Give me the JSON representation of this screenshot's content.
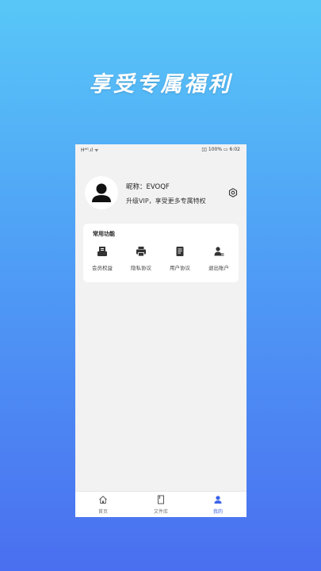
{
  "headline": "享受专属福利",
  "status_bar": {
    "left": "H⁴ᴳ.ıl ᯤ",
    "right": "▯▯ 100% ▭ 6:02"
  },
  "profile": {
    "nickname": "昵称：EVOQF",
    "vip_text": "升级VIP，享受更多专属特权"
  },
  "functions": {
    "title": "常用功能",
    "items": [
      {
        "label": "会员权益",
        "icon": "membership-icon"
      },
      {
        "label": "隐私协议",
        "icon": "printer-icon"
      },
      {
        "label": "用户协议",
        "icon": "document-icon"
      },
      {
        "label": "退出账户",
        "icon": "user-logout-icon"
      }
    ]
  },
  "tabs": [
    {
      "label": "首页",
      "icon": "home-icon"
    },
    {
      "label": "文件库",
      "icon": "file-icon"
    },
    {
      "label": "我的",
      "icon": "person-icon"
    }
  ],
  "colors": {
    "accent": "#3c64e8",
    "bg_top": "#58c7f7",
    "bg_bottom": "#4a6ff0"
  }
}
